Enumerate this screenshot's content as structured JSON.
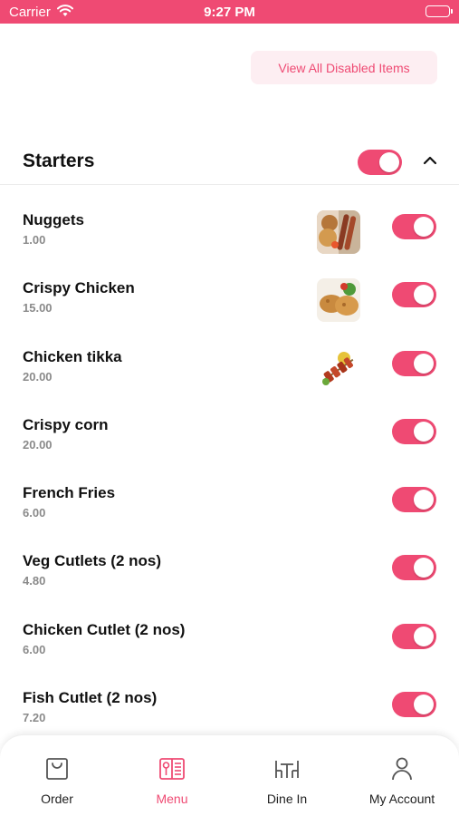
{
  "status_bar": {
    "carrier": "Carrier",
    "time": "9:27 PM"
  },
  "header": {
    "view_all_label": "View All Disabled Items"
  },
  "section": {
    "title": "Starters",
    "enabled": true,
    "expanded": true
  },
  "items": [
    {
      "name": "Nuggets",
      "price": "1.00",
      "has_image": true,
      "enabled": true
    },
    {
      "name": "Crispy Chicken",
      "price": "15.00",
      "has_image": true,
      "enabled": true
    },
    {
      "name": "Chicken tikka",
      "price": "20.00",
      "has_image": true,
      "enabled": true
    },
    {
      "name": "Crispy corn",
      "price": "20.00",
      "has_image": false,
      "enabled": true
    },
    {
      "name": "French Fries",
      "price": "6.00",
      "has_image": false,
      "enabled": true
    },
    {
      "name": "Veg Cutlets (2 nos)",
      "price": "4.80",
      "has_image": false,
      "enabled": true
    },
    {
      "name": "Chicken Cutlet (2 nos)",
      "price": "6.00",
      "has_image": false,
      "enabled": true
    },
    {
      "name": "Fish Cutlet (2 nos)",
      "price": "7.20",
      "has_image": false,
      "enabled": true
    }
  ],
  "tab_bar": {
    "tabs": [
      {
        "label": "Order",
        "icon": "shopping-bag-icon",
        "active": false
      },
      {
        "label": "Menu",
        "icon": "menu-book-icon",
        "active": true
      },
      {
        "label": "Dine In",
        "icon": "dine-in-table-icon",
        "active": false
      },
      {
        "label": "My Account",
        "icon": "user-icon",
        "active": false
      }
    ]
  },
  "colors": {
    "accent": "#ef4a73",
    "accent_light": "#fdeef2",
    "muted_text": "#8a8a8a"
  }
}
